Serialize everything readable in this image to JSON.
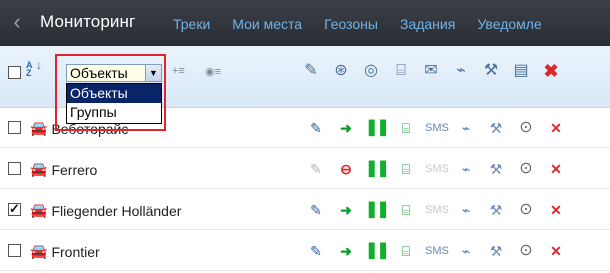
{
  "nav": {
    "back_icon": "chevron-left-icon",
    "title": "Мониторинг",
    "links": [
      "Треки",
      "Мои места",
      "Геозоны",
      "Задания",
      "Уведомле"
    ]
  },
  "toolbar": {
    "sort_label_top": "A",
    "sort_label_bottom": "Z",
    "select": {
      "value": "Объекты",
      "options": [
        "Объекты",
        "Группы"
      ],
      "selected_index": 0
    },
    "small_icons": [
      "add-list-icon",
      "list-icon"
    ],
    "action_icons": [
      "edit-icon",
      "commands-icon",
      "locator-icon",
      "computer-icon",
      "sms-icon",
      "satellite-icon",
      "tools-icon",
      "report-icon",
      "delete-icon"
    ]
  },
  "rows": [
    {
      "name": "Веботорайс",
      "checked": false,
      "pencil_grey": false,
      "status": "go",
      "sms_grey": false
    },
    {
      "name": "Ferrero",
      "checked": false,
      "pencil_grey": true,
      "status": "stop",
      "sms_grey": true
    },
    {
      "name": "Fliegender Holländer",
      "checked": true,
      "pencil_grey": false,
      "status": "go",
      "sms_grey": true
    },
    {
      "name": "Frontier",
      "checked": false,
      "pencil_grey": false,
      "status": "go",
      "sms_grey": false
    }
  ],
  "colors": {
    "nav_bg": "#2f3238",
    "nav_link": "#6fb3e8",
    "toolbar_bg": "#e2eef9",
    "highlight_border": "#e0262b",
    "select_selected_bg": "#0a246a",
    "delete_red": "#e0262b",
    "go_green": "#0a9f2b"
  }
}
